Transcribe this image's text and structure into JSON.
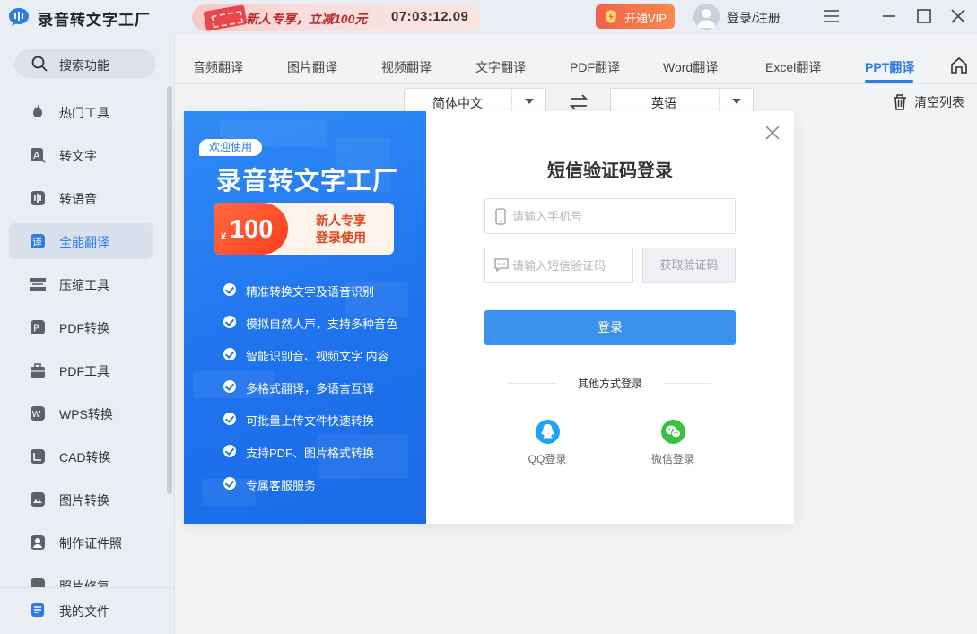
{
  "app": {
    "title": "录音转文字工厂"
  },
  "promo": {
    "text": "新人专享，立减100元",
    "timer": "07:03:12.09"
  },
  "header": {
    "vip_label": "开通VIP",
    "login_label": "登录/注册"
  },
  "sidebar": {
    "search_label": "搜索功能",
    "items": [
      {
        "label": "热门工具",
        "icon": "fire-icon"
      },
      {
        "label": "转文字",
        "icon": "text-convert-icon"
      },
      {
        "label": "转语音",
        "icon": "voice-icon"
      },
      {
        "label": "全能翻译",
        "icon": "translate-icon",
        "active": true
      },
      {
        "label": "压缩工具",
        "icon": "compress-icon"
      },
      {
        "label": "PDF转换",
        "icon": "pdf-convert-icon"
      },
      {
        "label": "PDF工具",
        "icon": "toolbox-icon"
      },
      {
        "label": "WPS转换",
        "icon": "wps-icon"
      },
      {
        "label": "CAD转换",
        "icon": "cad-icon"
      },
      {
        "label": "图片转换",
        "icon": "image-icon"
      },
      {
        "label": "制作证件照",
        "icon": "id-photo-icon"
      },
      {
        "label": "照片修复",
        "icon": "photo-repair-icon"
      }
    ],
    "bottom_label": "我的文件"
  },
  "tabs": [
    {
      "label": "音频翻译"
    },
    {
      "label": "图片翻译"
    },
    {
      "label": "视频翻译"
    },
    {
      "label": "文字翻译"
    },
    {
      "label": "PDF翻译"
    },
    {
      "label": "Word翻译"
    },
    {
      "label": "Excel翻译"
    },
    {
      "label": "PPT翻译",
      "active": true
    }
  ],
  "translate": {
    "source_lang": "简体中文",
    "target_lang": "英语",
    "clear_label": "清空列表"
  },
  "modal": {
    "welcome_tag": "欢迎使用",
    "promo_title": "录音转文字工厂",
    "coupon_currency": "¥",
    "coupon_amount": "100",
    "coupon_line1": "新人专享",
    "coupon_line2": "登录使用",
    "features": [
      "精准转换文字及语音识别",
      "模拟自然人声，支持多种音色",
      "智能识别音、视频文字 内容",
      "多格式翻译，多语言互译",
      "可批量上传文件快速转换",
      "支持PDF、图片格式转换",
      "专属客服服务"
    ],
    "form_title": "短信验证码登录",
    "phone_placeholder": "请输入手机号",
    "code_placeholder": "请输入短信验证码",
    "get_code_label": "获取验证码",
    "login_label": "登录",
    "other_login_label": "其他方式登录",
    "qq_label": "QQ登录",
    "wechat_label": "微信登录"
  },
  "colors": {
    "accent": "#2d7be5",
    "promo_panel": "#2279ee",
    "login_button": "#3c90ee",
    "vip": "#f0624a",
    "qq": "#1fa3f2",
    "wechat": "#3ac043"
  }
}
